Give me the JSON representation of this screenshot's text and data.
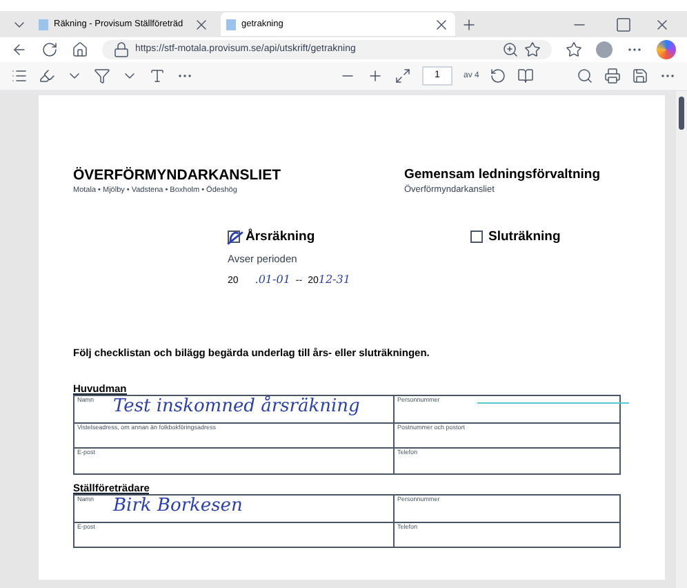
{
  "browser": {
    "tabs": [
      {
        "title": "Räkning - Provisum Ställföreträd",
        "selected": false
      },
      {
        "title": "getrakning",
        "selected": true
      }
    ],
    "url": "https://stf-motala.provisum.se/api/utskrift/getrakning",
    "pdf_toolbar": {
      "page": "1",
      "page_total": "av 4"
    }
  },
  "document": {
    "left_title": "ÖVERFÖRMYNDARKANSLIET",
    "left_subtitle": "Motala • Mjölby • Vadstena • Boxholm • Ödeshög",
    "right_title": "Gemensam ledningsförvaltning",
    "right_subtitle": "Överförmyndarkansliet",
    "options": [
      {
        "label": "Årsräkning",
        "checked": true
      },
      {
        "label": "Sluträkning",
        "checked": false
      }
    ],
    "period_label": "Avser perioden",
    "period": {
      "prefix_from": "20",
      "from": ".01-01",
      "separator": "--",
      "prefix_to": "20",
      "to": "12-31"
    },
    "instruction": "Följ checklistan och bilägg begärda underlag till års- eller sluträkningen.",
    "sections": [
      {
        "title": "Huvudman",
        "rows": [
          [
            {
              "label": "Namn",
              "value": "Test inskomned årsräkning"
            },
            {
              "label": "Personnummer"
            }
          ],
          [
            {
              "label": "Vistelseadress, om annan än folkbokföringsadress"
            },
            {
              "label": "Postnummer och postort"
            }
          ],
          [
            {
              "label": "E-post"
            },
            {
              "label": "Telefon"
            }
          ]
        ]
      },
      {
        "title": "Ställföreträdare",
        "rows": [
          [
            {
              "label": "Namn",
              "value": "Birk Borkesen"
            },
            {
              "label": "Personnummer"
            }
          ],
          [
            {
              "label": "E-post"
            },
            {
              "label": "Telefon"
            }
          ]
        ]
      }
    ]
  }
}
